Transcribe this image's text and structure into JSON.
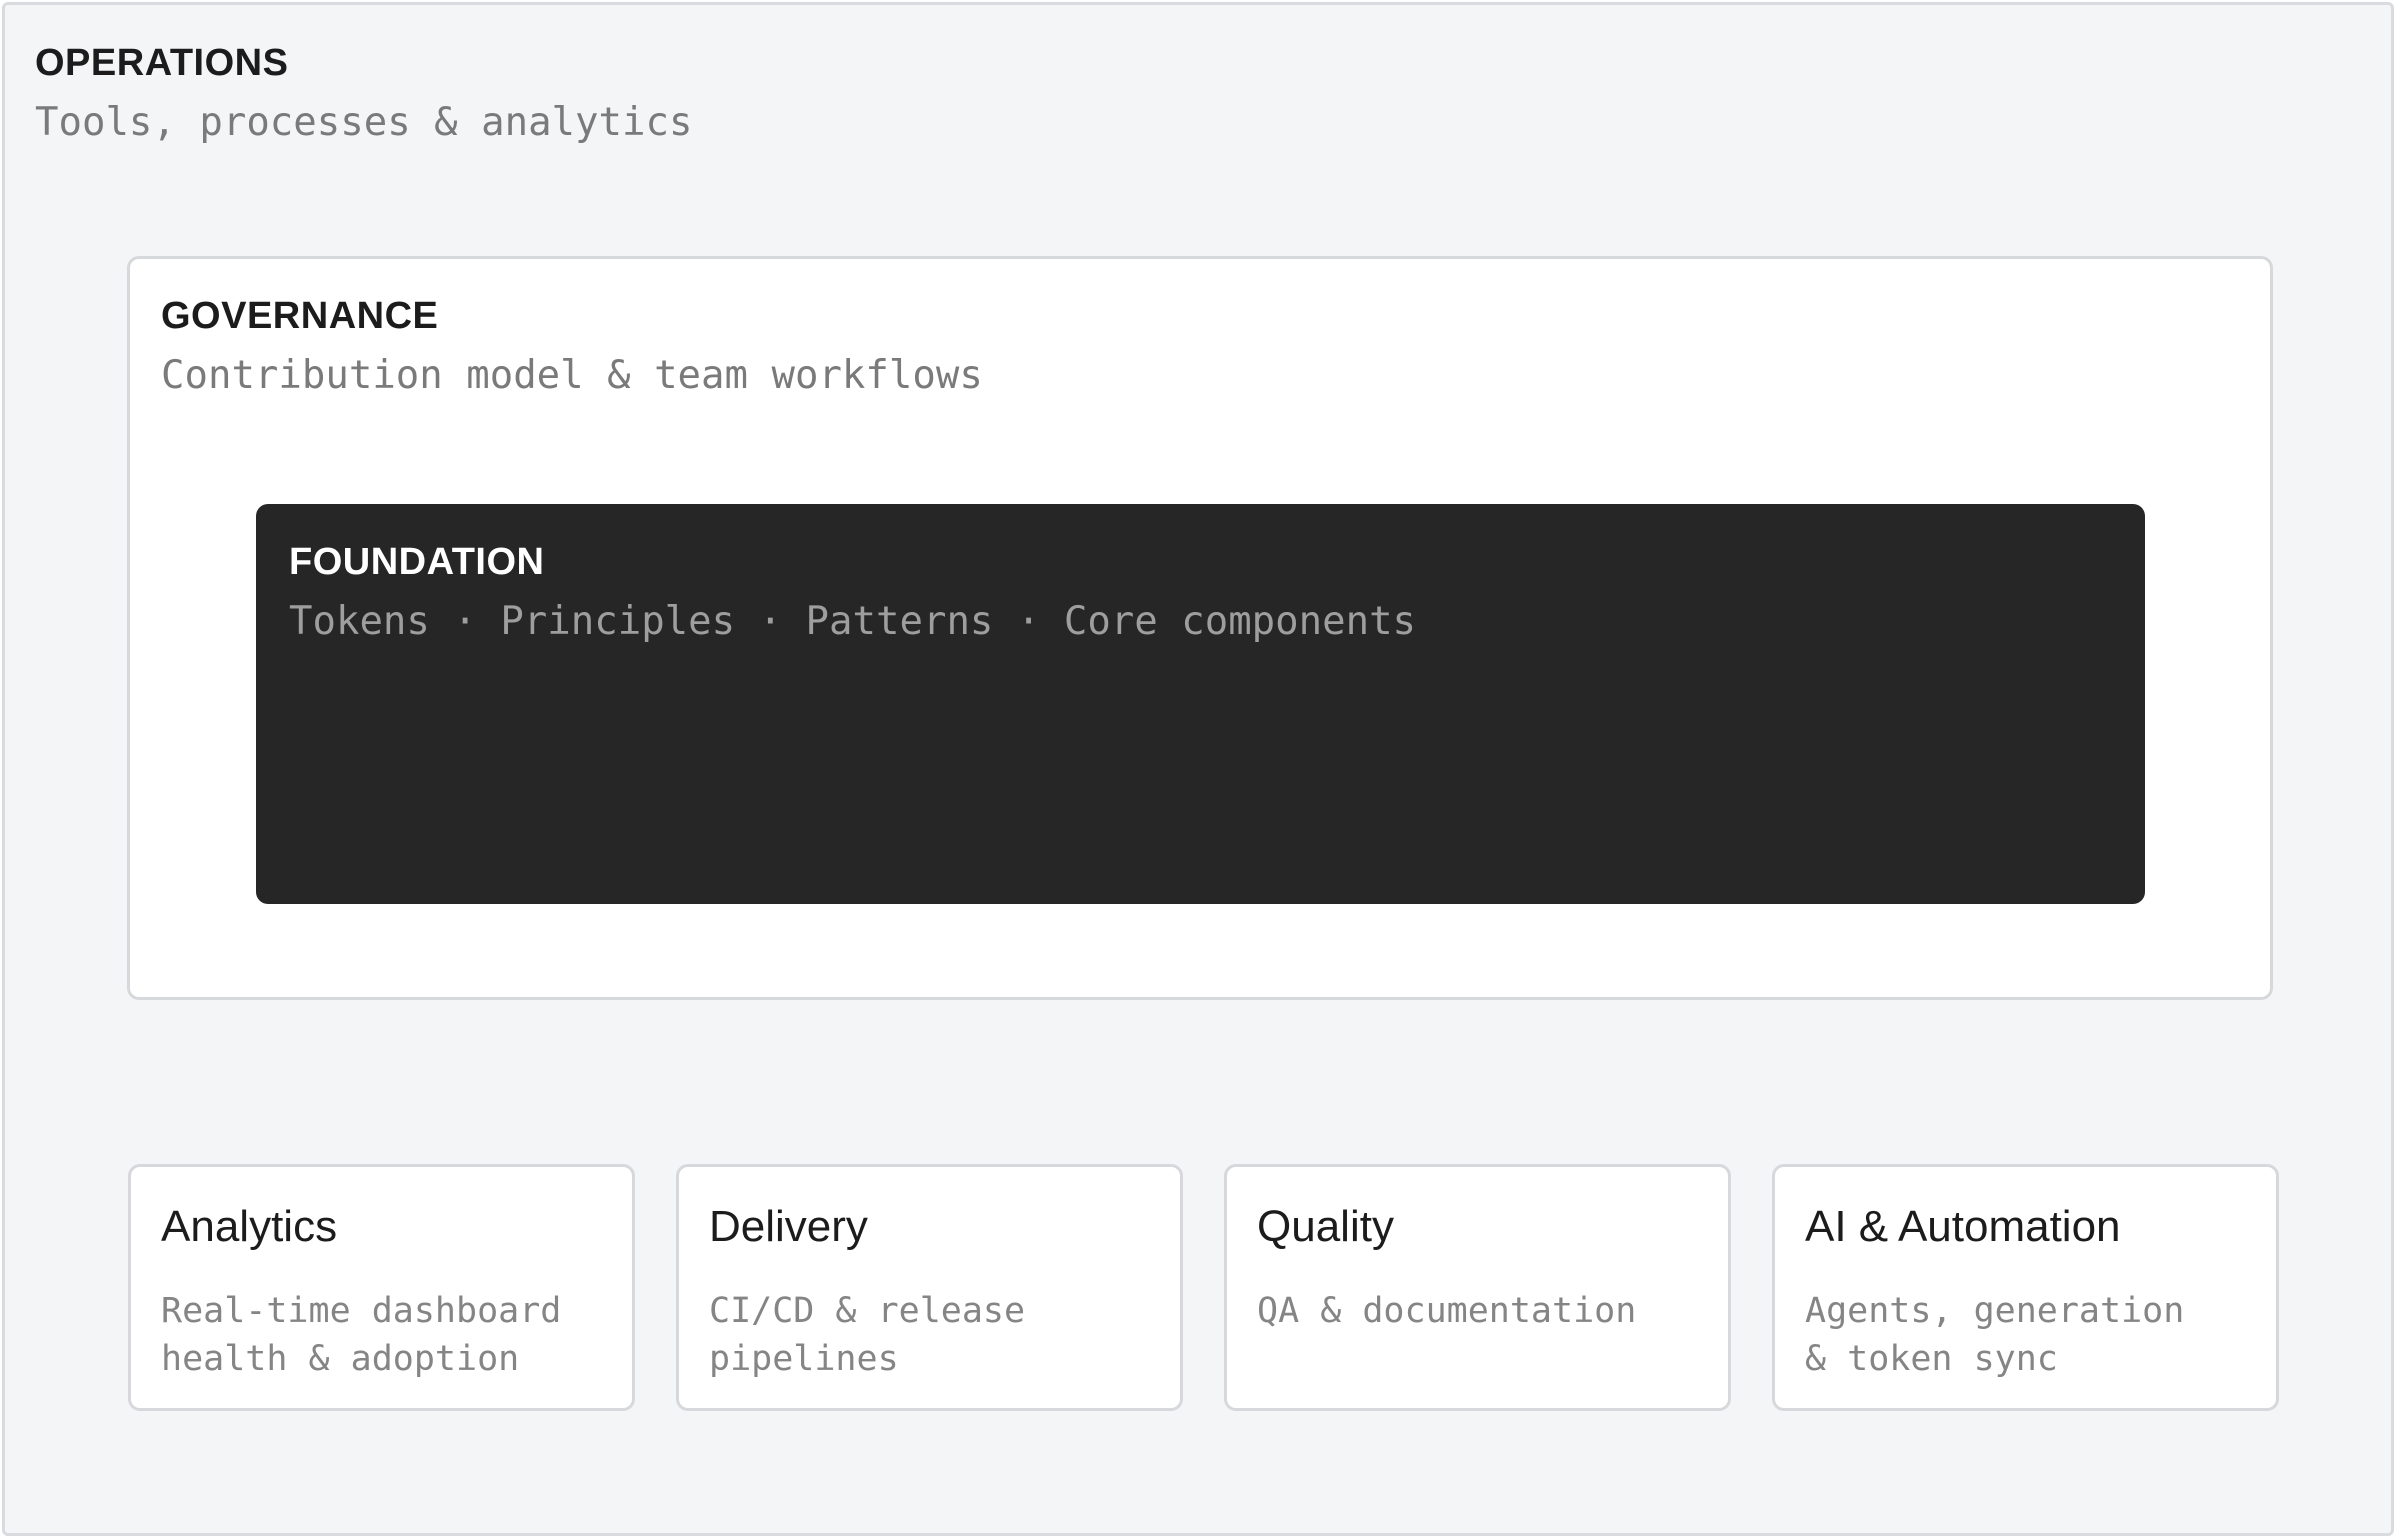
{
  "operations": {
    "title": "OPERATIONS",
    "subtitle": "Tools, processes & analytics"
  },
  "governance": {
    "title": "GOVERNANCE",
    "subtitle": "Contribution model & team workflows"
  },
  "foundation": {
    "title": "FOUNDATION",
    "subtitle": "Tokens · Principles · Patterns · Core components"
  },
  "cards": [
    {
      "title": "Analytics",
      "description": "Real-time dashboard\nhealth & adoption"
    },
    {
      "title": "Delivery",
      "description": "CI/CD & release\npipelines"
    },
    {
      "title": "Quality",
      "description": "QA & documentation"
    },
    {
      "title": "AI & Automation",
      "description": "Agents, generation\n& token sync"
    }
  ]
}
